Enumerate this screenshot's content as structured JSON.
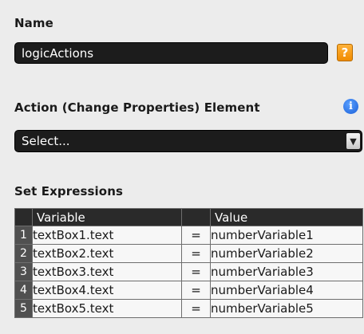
{
  "name_section": {
    "title": "Name",
    "value": "logicActions",
    "help_label": "?"
  },
  "action_section": {
    "title": "Action (Change Properties) Element",
    "info_label": "i",
    "select_value": "Select..."
  },
  "expressions_section": {
    "title": "Set Expressions",
    "columns": {
      "variable": "Variable",
      "value": "Value"
    },
    "rows": [
      {
        "index": "1",
        "variable": "textBox1.text",
        "operator": "=",
        "value": "numberVariable1"
      },
      {
        "index": "2",
        "variable": "textBox2.text",
        "operator": "=",
        "value": "numberVariable2"
      },
      {
        "index": "3",
        "variable": "textBox3.text",
        "operator": "=",
        "value": "numberVariable3"
      },
      {
        "index": "4",
        "variable": "textBox4.text",
        "operator": "=",
        "value": "numberVariable4"
      },
      {
        "index": "5",
        "variable": "textBox5.text",
        "operator": "=",
        "value": "numberVariable5"
      }
    ]
  },
  "colors": {
    "background": "#ececec",
    "field_dark": "#1c1c1c",
    "help_orange": "#f39a10",
    "info_blue": "#2a6fe0"
  }
}
